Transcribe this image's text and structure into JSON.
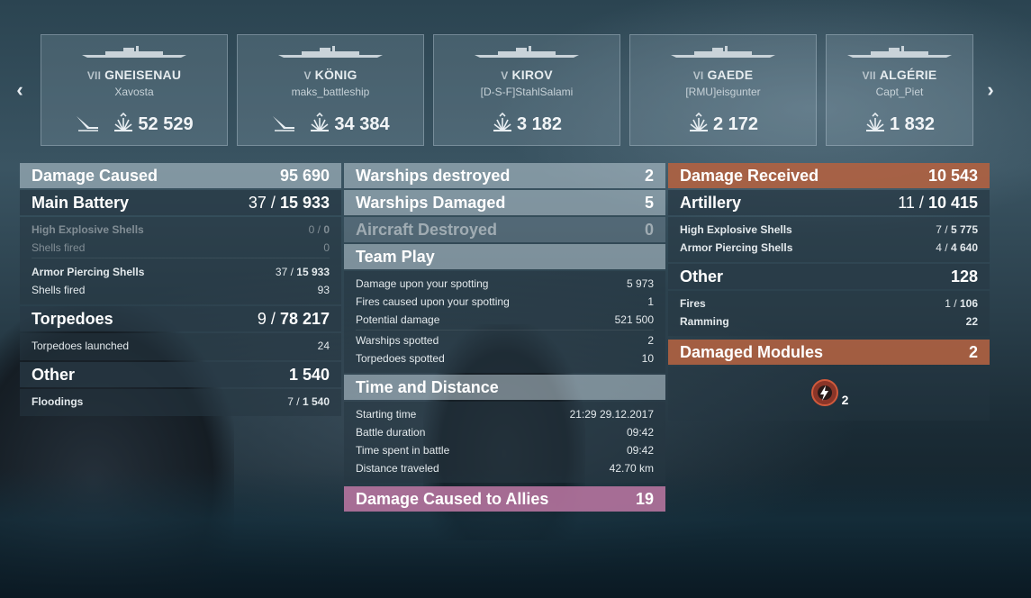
{
  "ships": [
    {
      "tier": "VII",
      "name": "GNEISENAU",
      "player": "Xavosta",
      "damage": "52 529",
      "icons": [
        "torpedo-icon",
        "explosion-icon"
      ]
    },
    {
      "tier": "V",
      "name": "KÖNIG",
      "player": "maks_battleship",
      "damage": "34 384",
      "icons": [
        "torpedo-icon",
        "explosion-icon"
      ]
    },
    {
      "tier": "V",
      "name": "KIROV",
      "player": "[D-S-F]StahlSalami",
      "damage": "3 182",
      "icons": [
        "explosion-icon"
      ]
    },
    {
      "tier": "VI",
      "name": "GAEDE",
      "player": "[RMU]eisgunter",
      "damage": "2 172",
      "icons": [
        "explosion-icon"
      ]
    },
    {
      "tier": "VII",
      "name": "ALGÉRIE",
      "player": "Capt_Piet",
      "damage": "1 832",
      "icons": [
        "explosion-icon"
      ]
    }
  ],
  "damage_caused": {
    "label": "Damage Caused",
    "value": "95 690",
    "main_battery": {
      "label": "Main Battery",
      "hits": "37",
      "value": "15 933"
    },
    "he_shells": {
      "label": "High Explosive Shells",
      "hits": "0",
      "value": "0"
    },
    "he_fired": {
      "label": "Shells fired",
      "value": "0"
    },
    "ap_shells": {
      "label": "Armor Piercing Shells",
      "hits": "37",
      "value": "15 933"
    },
    "ap_fired": {
      "label": "Shells fired",
      "value": "93"
    },
    "torpedoes": {
      "label": "Torpedoes",
      "hits": "9",
      "value": "78 217"
    },
    "torp_launched": {
      "label": "Torpedoes launched",
      "value": "24"
    },
    "other": {
      "label": "Other",
      "value": "1 540"
    },
    "floodings": {
      "label": "Floodings",
      "hits": "7",
      "value": "1 540"
    }
  },
  "middle": {
    "warships_destroyed": {
      "label": "Warships destroyed",
      "value": "2"
    },
    "warships_damaged": {
      "label": "Warships Damaged",
      "value": "5"
    },
    "aircraft_destroyed": {
      "label": "Aircraft Destroyed",
      "value": "0"
    },
    "team_play": {
      "label": "Team Play",
      "rows": [
        {
          "label": "Damage upon your spotting",
          "value": "5 973"
        },
        {
          "label": "Fires caused upon your spotting",
          "value": "1"
        },
        {
          "label": "Potential damage",
          "value": "521 500"
        },
        {
          "label": "Warships spotted",
          "value": "2"
        },
        {
          "label": "Torpedoes spotted",
          "value": "10"
        }
      ]
    },
    "time_distance": {
      "label": "Time and Distance",
      "rows": [
        {
          "label": "Starting time",
          "value": "21:29  29.12.2017"
        },
        {
          "label": "Battle duration",
          "value": "09:42"
        },
        {
          "label": "Time spent in battle",
          "value": "09:42"
        },
        {
          "label": "Distance traveled",
          "value": "42.70 km"
        }
      ]
    },
    "allies_damage": {
      "label": "Damage Caused to Allies",
      "value": "19"
    }
  },
  "damage_received": {
    "label": "Damage Received",
    "value": "10 543",
    "artillery": {
      "label": "Artillery",
      "hits": "11",
      "value": "10 415"
    },
    "he_shells": {
      "label": "High Explosive Shells",
      "hits": "7",
      "value": "5 775"
    },
    "ap_shells": {
      "label": "Armor Piercing Shells",
      "hits": "4",
      "value": "4 640"
    },
    "other": {
      "label": "Other",
      "value": "128"
    },
    "fires": {
      "label": "Fires",
      "hits": "1",
      "value": "106"
    },
    "ramming": {
      "label": "Ramming",
      "value": "22"
    },
    "damaged_modules": {
      "label": "Damaged Modules",
      "value": "2"
    },
    "module_count": "2"
  },
  "colors": {
    "received_header": "#b06241",
    "allies_header": "#be78a5"
  }
}
